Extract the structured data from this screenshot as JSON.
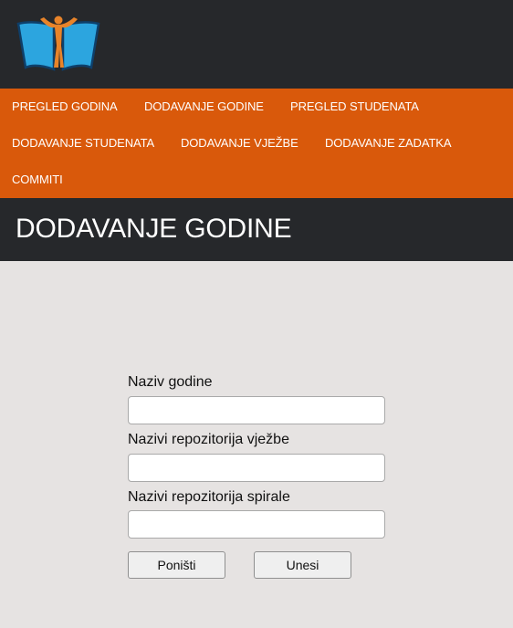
{
  "nav": {
    "items": [
      {
        "label": "PREGLED GODINA"
      },
      {
        "label": "DODAVANJE GODINE"
      },
      {
        "label": "PREGLED STUDENATA"
      },
      {
        "label": "DODAVANJE STUDENATA"
      },
      {
        "label": "DODAVANJE VJEŽBE"
      },
      {
        "label": "DODAVANJE ZADATKA"
      },
      {
        "label": "COMMITI"
      }
    ]
  },
  "page": {
    "title": "DODAVANJE GODINE"
  },
  "form": {
    "year_name_label": "Naziv godine",
    "year_name_value": "",
    "exercise_repos_label": "Nazivi repozitorija vježbe",
    "exercise_repos_value": "",
    "spiral_repos_label": "Nazivi repozitorija spirale",
    "spiral_repos_value": "",
    "reset_label": "Poništi",
    "submit_label": "Unesi"
  },
  "colors": {
    "header_bg": "#26282b",
    "nav_bg": "#d9590b",
    "page_bg": "#e6e3e2",
    "logo_blue": "#29a3de",
    "logo_orange": "#e8842a"
  },
  "icons": {
    "logo": "book-person-logo-icon"
  }
}
